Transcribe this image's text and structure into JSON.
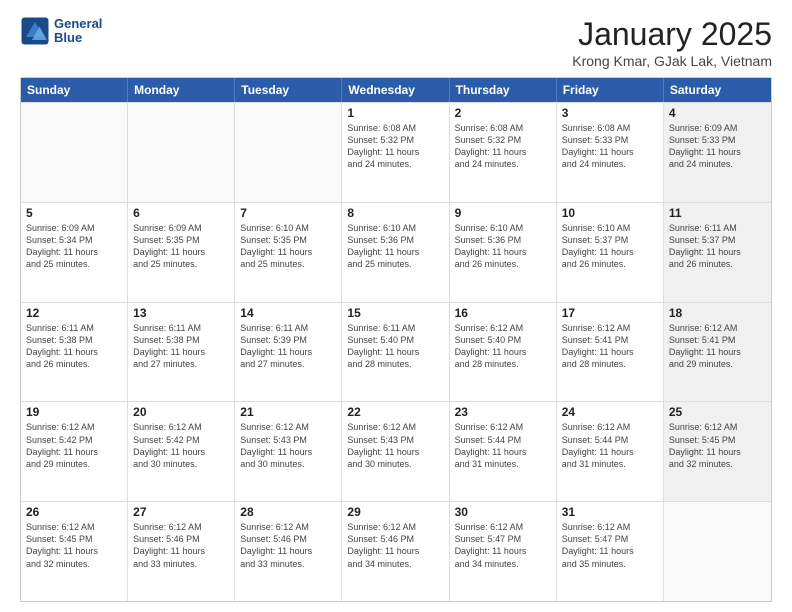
{
  "header": {
    "logo_line1": "General",
    "logo_line2": "Blue",
    "title": "January 2025",
    "subtitle": "Krong Kmar, GJak Lak, Vietnam"
  },
  "weekdays": [
    "Sunday",
    "Monday",
    "Tuesday",
    "Wednesday",
    "Thursday",
    "Friday",
    "Saturday"
  ],
  "rows": [
    [
      {
        "day": "",
        "info": "",
        "empty": true
      },
      {
        "day": "",
        "info": "",
        "empty": true
      },
      {
        "day": "",
        "info": "",
        "empty": true
      },
      {
        "day": "1",
        "info": "Sunrise: 6:08 AM\nSunset: 5:32 PM\nDaylight: 11 hours\nand 24 minutes.",
        "empty": false
      },
      {
        "day": "2",
        "info": "Sunrise: 6:08 AM\nSunset: 5:32 PM\nDaylight: 11 hours\nand 24 minutes.",
        "empty": false
      },
      {
        "day": "3",
        "info": "Sunrise: 6:08 AM\nSunset: 5:33 PM\nDaylight: 11 hours\nand 24 minutes.",
        "empty": false
      },
      {
        "day": "4",
        "info": "Sunrise: 6:09 AM\nSunset: 5:33 PM\nDaylight: 11 hours\nand 24 minutes.",
        "empty": false,
        "shaded": true
      }
    ],
    [
      {
        "day": "5",
        "info": "Sunrise: 6:09 AM\nSunset: 5:34 PM\nDaylight: 11 hours\nand 25 minutes.",
        "empty": false
      },
      {
        "day": "6",
        "info": "Sunrise: 6:09 AM\nSunset: 5:35 PM\nDaylight: 11 hours\nand 25 minutes.",
        "empty": false
      },
      {
        "day": "7",
        "info": "Sunrise: 6:10 AM\nSunset: 5:35 PM\nDaylight: 11 hours\nand 25 minutes.",
        "empty": false
      },
      {
        "day": "8",
        "info": "Sunrise: 6:10 AM\nSunset: 5:36 PM\nDaylight: 11 hours\nand 25 minutes.",
        "empty": false
      },
      {
        "day": "9",
        "info": "Sunrise: 6:10 AM\nSunset: 5:36 PM\nDaylight: 11 hours\nand 26 minutes.",
        "empty": false
      },
      {
        "day": "10",
        "info": "Sunrise: 6:10 AM\nSunset: 5:37 PM\nDaylight: 11 hours\nand 26 minutes.",
        "empty": false
      },
      {
        "day": "11",
        "info": "Sunrise: 6:11 AM\nSunset: 5:37 PM\nDaylight: 11 hours\nand 26 minutes.",
        "empty": false,
        "shaded": true
      }
    ],
    [
      {
        "day": "12",
        "info": "Sunrise: 6:11 AM\nSunset: 5:38 PM\nDaylight: 11 hours\nand 26 minutes.",
        "empty": false
      },
      {
        "day": "13",
        "info": "Sunrise: 6:11 AM\nSunset: 5:38 PM\nDaylight: 11 hours\nand 27 minutes.",
        "empty": false
      },
      {
        "day": "14",
        "info": "Sunrise: 6:11 AM\nSunset: 5:39 PM\nDaylight: 11 hours\nand 27 minutes.",
        "empty": false
      },
      {
        "day": "15",
        "info": "Sunrise: 6:11 AM\nSunset: 5:40 PM\nDaylight: 11 hours\nand 28 minutes.",
        "empty": false
      },
      {
        "day": "16",
        "info": "Sunrise: 6:12 AM\nSunset: 5:40 PM\nDaylight: 11 hours\nand 28 minutes.",
        "empty": false
      },
      {
        "day": "17",
        "info": "Sunrise: 6:12 AM\nSunset: 5:41 PM\nDaylight: 11 hours\nand 28 minutes.",
        "empty": false
      },
      {
        "day": "18",
        "info": "Sunrise: 6:12 AM\nSunset: 5:41 PM\nDaylight: 11 hours\nand 29 minutes.",
        "empty": false,
        "shaded": true
      }
    ],
    [
      {
        "day": "19",
        "info": "Sunrise: 6:12 AM\nSunset: 5:42 PM\nDaylight: 11 hours\nand 29 minutes.",
        "empty": false
      },
      {
        "day": "20",
        "info": "Sunrise: 6:12 AM\nSunset: 5:42 PM\nDaylight: 11 hours\nand 30 minutes.",
        "empty": false
      },
      {
        "day": "21",
        "info": "Sunrise: 6:12 AM\nSunset: 5:43 PM\nDaylight: 11 hours\nand 30 minutes.",
        "empty": false
      },
      {
        "day": "22",
        "info": "Sunrise: 6:12 AM\nSunset: 5:43 PM\nDaylight: 11 hours\nand 30 minutes.",
        "empty": false
      },
      {
        "day": "23",
        "info": "Sunrise: 6:12 AM\nSunset: 5:44 PM\nDaylight: 11 hours\nand 31 minutes.",
        "empty": false
      },
      {
        "day": "24",
        "info": "Sunrise: 6:12 AM\nSunset: 5:44 PM\nDaylight: 11 hours\nand 31 minutes.",
        "empty": false
      },
      {
        "day": "25",
        "info": "Sunrise: 6:12 AM\nSunset: 5:45 PM\nDaylight: 11 hours\nand 32 minutes.",
        "empty": false,
        "shaded": true
      }
    ],
    [
      {
        "day": "26",
        "info": "Sunrise: 6:12 AM\nSunset: 5:45 PM\nDaylight: 11 hours\nand 32 minutes.",
        "empty": false
      },
      {
        "day": "27",
        "info": "Sunrise: 6:12 AM\nSunset: 5:46 PM\nDaylight: 11 hours\nand 33 minutes.",
        "empty": false
      },
      {
        "day": "28",
        "info": "Sunrise: 6:12 AM\nSunset: 5:46 PM\nDaylight: 11 hours\nand 33 minutes.",
        "empty": false
      },
      {
        "day": "29",
        "info": "Sunrise: 6:12 AM\nSunset: 5:46 PM\nDaylight: 11 hours\nand 34 minutes.",
        "empty": false
      },
      {
        "day": "30",
        "info": "Sunrise: 6:12 AM\nSunset: 5:47 PM\nDaylight: 11 hours\nand 34 minutes.",
        "empty": false
      },
      {
        "day": "31",
        "info": "Sunrise: 6:12 AM\nSunset: 5:47 PM\nDaylight: 11 hours\nand 35 minutes.",
        "empty": false
      },
      {
        "day": "",
        "info": "",
        "empty": true
      }
    ]
  ]
}
